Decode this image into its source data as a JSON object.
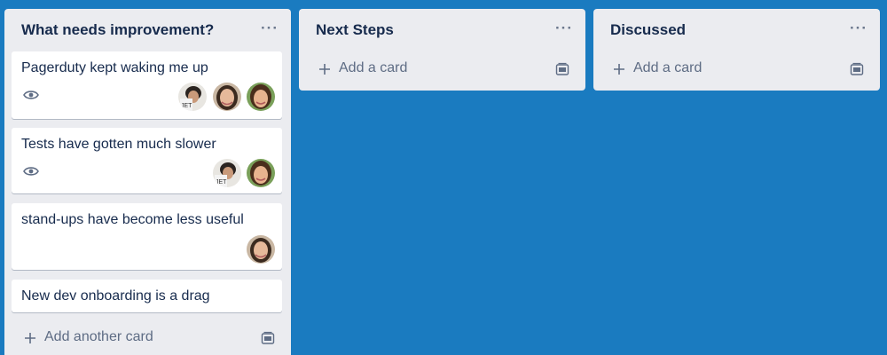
{
  "colors": {
    "board_bg": "#1a7bc0",
    "list_bg": "#ebecf0",
    "card_bg": "#ffffff",
    "title_text": "#172b4d",
    "muted_text": "#5e6c84"
  },
  "lists": [
    {
      "title": "What needs improvement?",
      "menu": "···",
      "cards": [
        {
          "title": "Pagerduty kept waking me up",
          "watch_icon": "eye-icon",
          "avatars": [
            "avatar-member-a",
            "avatar-member-b",
            "avatar-member-c"
          ]
        },
        {
          "title": "Tests have gotten much slower",
          "watch_icon": "eye-icon",
          "avatars": [
            "avatar-member-a",
            "avatar-member-c"
          ]
        },
        {
          "title": "stand-ups have become less useful",
          "avatars": [
            "avatar-member-b"
          ]
        },
        {
          "title": "New dev onboarding is a drag"
        }
      ],
      "add_label": "Add another card",
      "template_icon": "card-template-icon"
    },
    {
      "title": "Next Steps",
      "menu": "···",
      "cards": [],
      "add_label": "Add a card",
      "template_icon": "card-template-icon"
    },
    {
      "title": "Discussed",
      "menu": "···",
      "cards": [],
      "add_label": "Add a card",
      "template_icon": "card-template-icon"
    }
  ]
}
